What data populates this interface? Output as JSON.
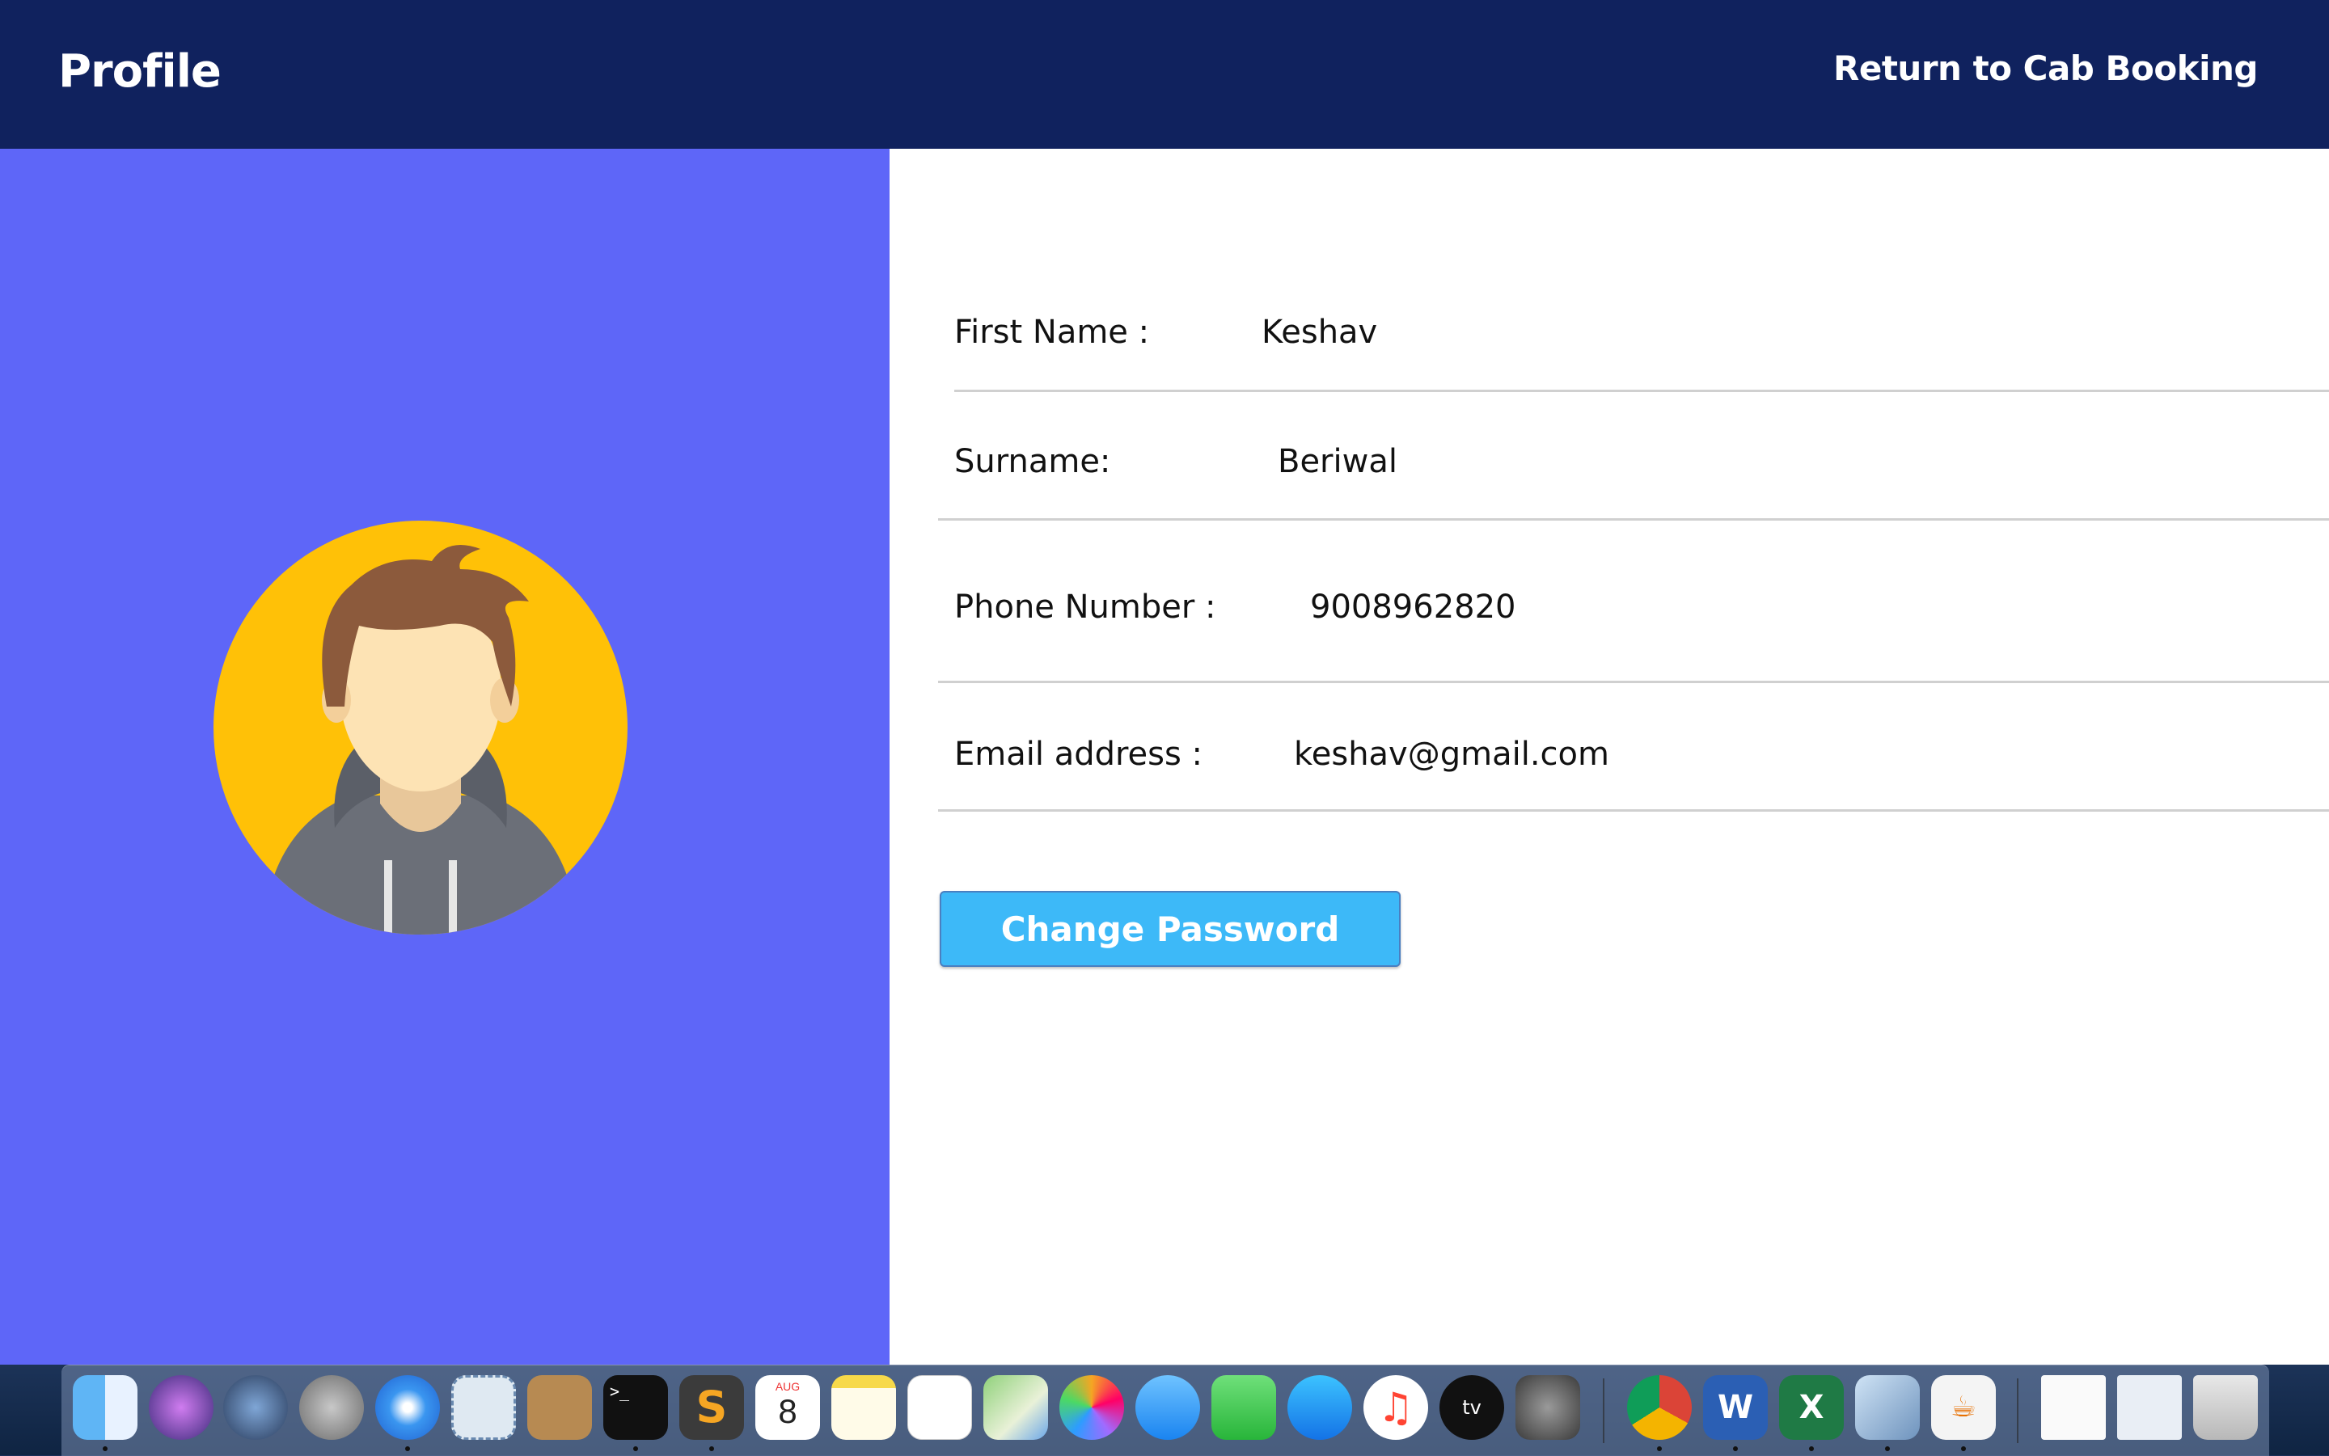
{
  "header": {
    "title": "Profile",
    "return_link": "Return to Cab Booking"
  },
  "profile": {
    "fields": [
      {
        "label": "First Name :",
        "value": "Keshav"
      },
      {
        "label": "Surname:",
        "value": "Beriwal"
      },
      {
        "label": "Phone Number :",
        "value": "9008962820"
      },
      {
        "label": "Email address :",
        "value": "keshav@gmail.com"
      }
    ],
    "change_password_label": "Change Password"
  },
  "dock": {
    "calendar_month": "AUG",
    "calendar_day": "8",
    "apps": [
      "finder-icon",
      "siri-icon",
      "quicktime-icon",
      "launchpad-icon",
      "safari-icon",
      "mail-icon",
      "contacts-icon",
      "terminal-icon",
      "sublime-icon",
      "calendar-icon",
      "notes-icon",
      "reminders-icon",
      "maps-icon",
      "photos-icon",
      "messages-icon",
      "facetime-icon",
      "app-store-icon",
      "music-icon",
      "apple-tv-icon",
      "system-preferences-icon",
      "chrome-icon",
      "word-icon",
      "excel-icon",
      "virtualbox-icon",
      "java-icon",
      "document-icon",
      "preview-icon",
      "trash-icon"
    ]
  },
  "colors": {
    "header_bg": "#10225e",
    "left_panel": "#5e66f8",
    "button_bg": "#3db9f8",
    "avatar_bg": "#ffc107"
  }
}
